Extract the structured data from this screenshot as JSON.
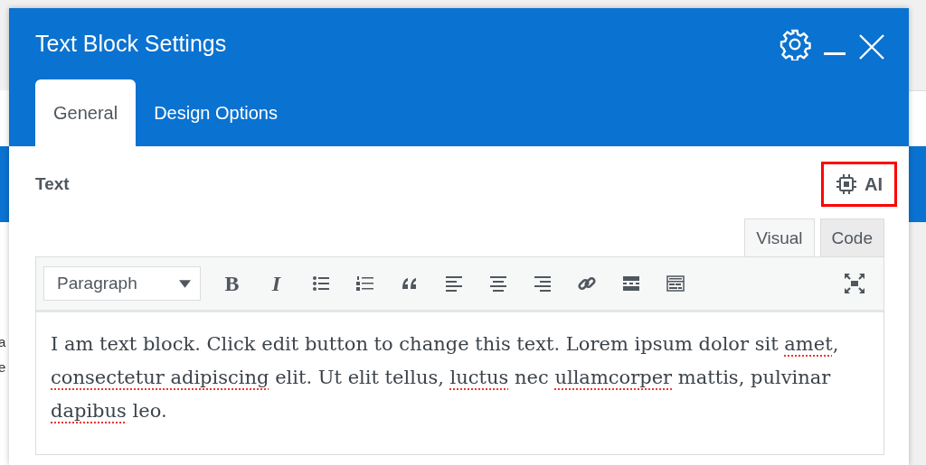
{
  "background": {
    "fragments": [
      "a",
      "e"
    ]
  },
  "dialog": {
    "title": "Text Block Settings",
    "tabs": [
      {
        "label": "General",
        "selected": true
      },
      {
        "label": "Design Options",
        "selected": false
      }
    ],
    "field_label": "Text",
    "ai_button": {
      "label": "AI",
      "highlighted": true
    },
    "editor_tabs": [
      {
        "label": "Visual",
        "selected": true
      },
      {
        "label": "Code",
        "selected": false
      }
    ],
    "format_select": {
      "value": "Paragraph"
    },
    "toolbar": [
      {
        "kind": "bold",
        "label": "B"
      },
      {
        "kind": "italic",
        "label": "I"
      },
      {
        "kind": "bullets"
      },
      {
        "kind": "numbers"
      },
      {
        "kind": "quote"
      },
      {
        "kind": "align-left"
      },
      {
        "kind": "align-center"
      },
      {
        "kind": "align-right"
      },
      {
        "kind": "link"
      },
      {
        "kind": "more"
      },
      {
        "kind": "kitchen"
      }
    ],
    "content": [
      {
        "text": "I am text block. Click edit button to change this text. Lorem ipsum dolor sit ",
        "misspelled": false
      },
      {
        "text": "amet",
        "misspelled": true
      },
      {
        "text": ", ",
        "misspelled": false
      },
      {
        "text": "consectetur adipiscing",
        "misspelled": true
      },
      {
        "text": " elit. Ut elit tellus, ",
        "misspelled": false
      },
      {
        "text": "luctus",
        "misspelled": true
      },
      {
        "text": " nec ",
        "misspelled": false
      },
      {
        "text": "ullamcorper",
        "misspelled": true
      },
      {
        "text": " mattis, pulvinar ",
        "misspelled": false
      },
      {
        "text": "dapibus",
        "misspelled": true
      },
      {
        "text": " leo.",
        "misspelled": false
      }
    ]
  }
}
